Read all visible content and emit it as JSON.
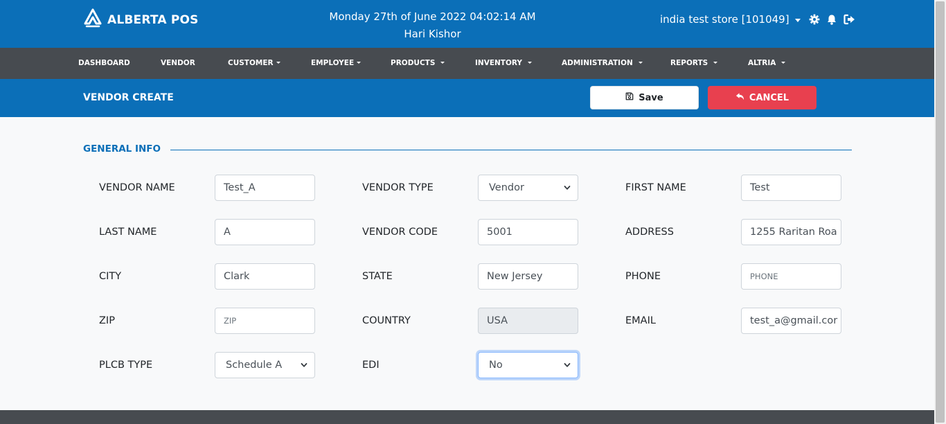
{
  "header": {
    "brand": "ALBERTA POS",
    "datetime": "Monday 27th of June 2022 04:02:14 AM",
    "user": "Hari Kishor",
    "store": "india test store [101049]"
  },
  "nav": [
    {
      "label": "DASHBOARD",
      "has_caret": false
    },
    {
      "label": "VENDOR",
      "has_caret": false
    },
    {
      "label": "CUSTOMER",
      "has_caret": true
    },
    {
      "label": "EMPLOYEE",
      "has_caret": true
    },
    {
      "label": "PRODUCTS",
      "has_caret": true
    },
    {
      "label": "INVENTORY",
      "has_caret": true
    },
    {
      "label": "ADMINISTRATION",
      "has_caret": true
    },
    {
      "label": "REPORTS",
      "has_caret": true
    },
    {
      "label": "ALTRIA",
      "has_caret": true
    }
  ],
  "page": {
    "title": "VENDOR CREATE",
    "save_label": "Save",
    "cancel_label": "CANCEL"
  },
  "section": {
    "title": "GENERAL INFO"
  },
  "fields": {
    "vendor_name": {
      "label": "VENDOR NAME",
      "value": "Test_A"
    },
    "vendor_type": {
      "label": "VENDOR TYPE",
      "value": "Vendor"
    },
    "first_name": {
      "label": "FIRST NAME",
      "value": "Test"
    },
    "last_name": {
      "label": "LAST NAME",
      "value": "A"
    },
    "vendor_code": {
      "label": "VENDOR CODE",
      "value": "5001"
    },
    "address": {
      "label": "ADDRESS",
      "value": "1255 Raritan Roa"
    },
    "city": {
      "label": "CITY",
      "value": "Clark"
    },
    "state": {
      "label": "STATE",
      "value": "New Jersey"
    },
    "phone": {
      "label": "PHONE",
      "placeholder": "PHONE"
    },
    "zip": {
      "label": "ZIP",
      "placeholder": "ZIP"
    },
    "country": {
      "label": "COUNTRY",
      "value": "USA"
    },
    "email": {
      "label": "EMAIL",
      "value": "test_a@gmail.cor"
    },
    "plcb_type": {
      "label": "PLCB TYPE",
      "value": "Schedule A"
    },
    "edi": {
      "label": "EDI",
      "value": "No"
    }
  },
  "colors": {
    "primary": "#0b6fb8",
    "nav_bg": "#474b50",
    "cancel": "#e8404f"
  },
  "icons": [
    "logo-icon",
    "chevron-down-icon",
    "gear-icon",
    "bell-icon",
    "logout-icon",
    "floppy-disk-icon",
    "undo-arrow-icon"
  ]
}
